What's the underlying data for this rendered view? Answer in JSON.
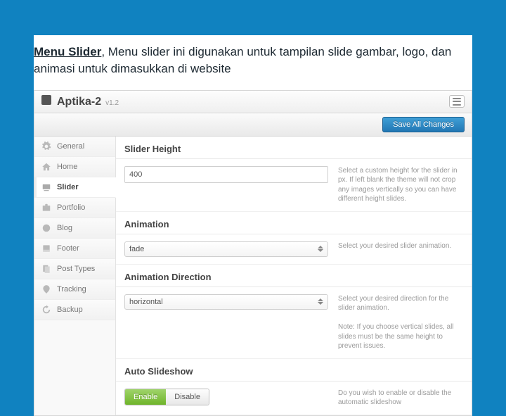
{
  "caption_bold": "Menu Slider",
  "caption_rest": ", Menu slider ini digunakan untuk tampilan slide gambar, logo, dan animasi untuk dimasukkan di website",
  "brand": {
    "name": "Aptika-2",
    "version": "v1.2"
  },
  "save_label": "Save All Changes",
  "sidebar": {
    "items": [
      {
        "label": "General",
        "icon": "gear-icon"
      },
      {
        "label": "Home",
        "icon": "home-icon"
      },
      {
        "label": "Slider",
        "icon": "slider-icon"
      },
      {
        "label": "Portfolio",
        "icon": "portfolio-icon"
      },
      {
        "label": "Blog",
        "icon": "blog-icon"
      },
      {
        "label": "Footer",
        "icon": "footer-icon"
      },
      {
        "label": "Post Types",
        "icon": "post-types-icon"
      },
      {
        "label": "Tracking",
        "icon": "tracking-icon"
      },
      {
        "label": "Backup",
        "icon": "backup-icon"
      }
    ],
    "active_index": 2
  },
  "sections": {
    "slider_height": {
      "title": "Slider Height",
      "value": "400",
      "help": "Select a custom height for the slider in px. If left blank the theme will not crop any images vertically so you can have different height slides."
    },
    "animation": {
      "title": "Animation",
      "value": "fade",
      "help": "Select your desired slider animation."
    },
    "animation_direction": {
      "title": "Animation Direction",
      "value": "horizontal",
      "help": "Select your desired direction for the slider animation.",
      "note": "Note: If you choose vertical slides, all slides must be the same height to prevent issues."
    },
    "auto_slideshow": {
      "title": "Auto Slideshow",
      "enable": "Enable",
      "disable": "Disable",
      "help": "Do you wish to enable or disable the automatic slideshow"
    }
  }
}
